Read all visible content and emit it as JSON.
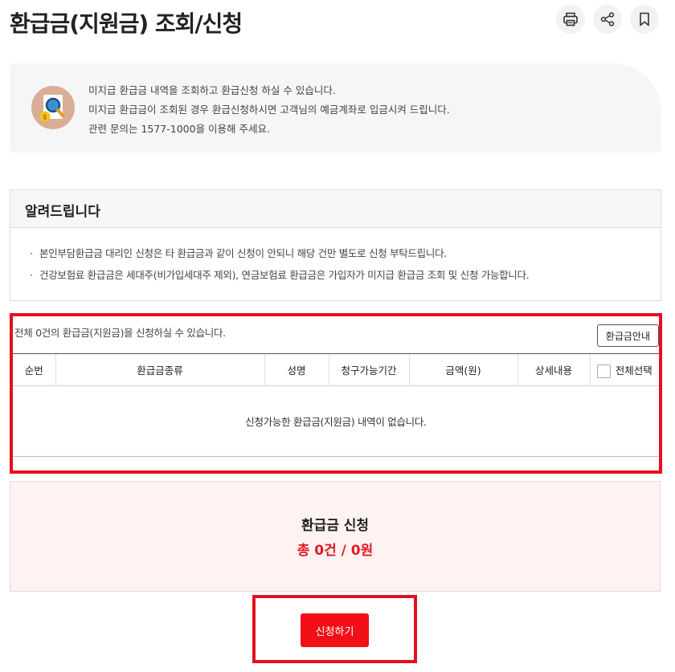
{
  "header": {
    "title": "환급금(지원금) 조회/신청",
    "actions": [
      {
        "icon": "print-icon"
      },
      {
        "icon": "share-icon"
      },
      {
        "icon": "bookmark-icon"
      }
    ]
  },
  "info": {
    "icon": "magnifier-document-icon",
    "lines": [
      "미지급 환급금 내역을 조회하고 환급신청 하실 수 있습니다.",
      "미지급 환급금이 조회된 경우 환급신청하시면 고객님의 예금계좌로 입금시켜 드립니다.",
      "관련 문의는 1577-1000을 이용해 주세요."
    ]
  },
  "notice": {
    "title": "알려드립니다",
    "items": [
      "본인부담환급금 대리인 신청은 타 환급금과 같이 신청이 안되니 해당 건만 별도로 신청 부탁드립니다.",
      "건강보험료 환급금은 세대주(비가입세대주 제외), 연금보험료 환급금은 가입자가 미지급 환급금 조회 및 신청 가능합니다."
    ]
  },
  "list": {
    "total_text": "전체 0건의 환급금(지원금)을 신청하실 수 있습니다.",
    "guide_button": "환급금안내",
    "columns": [
      "순번",
      "환급금종류",
      "성명",
      "청구가능기간",
      "금액(원)",
      "상세내용",
      "전체선택"
    ],
    "empty_message": "신청가능한 환급금(지원금) 내역이 없습니다."
  },
  "summary": {
    "title": "환급금 신청",
    "amount": "총 0건 / 0원"
  },
  "apply_button": "신청하기",
  "colors": {
    "accent_red": "#e5101e",
    "button_red": "#f20f16",
    "summary_bg": "#fff2f2"
  }
}
